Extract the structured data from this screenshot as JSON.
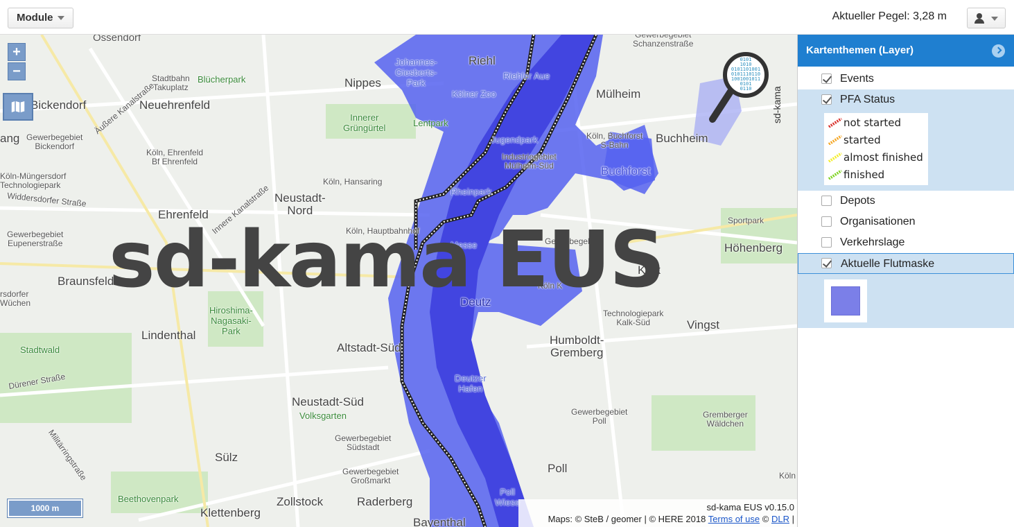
{
  "topbar": {
    "module_label": "Module",
    "pegel_text": "Aktueller Pegel: 3,28 m",
    "user_icon": "user-icon"
  },
  "map": {
    "zoom_in": "+",
    "zoom_out": "−",
    "watermark": "sd-kama EUS",
    "scale": "1000 m",
    "version": "sd-kama EUS v0.15.0",
    "attribution_prefix": "Maps: © SteB / geomer | © HERE 2018",
    "terms_link": "Terms of use",
    "copyright_sep": "©",
    "dlr_link": "DLR",
    "trailing": "|",
    "side_label": "sd-kama",
    "logo_digits": "0101\n1010\n0101101001\n0101110110\n1001001011\n0101\n0110",
    "flood_color": "#5561f0",
    "labels": {
      "ossendorf": "Ossendorf",
      "riehl": "Riehl",
      "nippes": "Nippes",
      "mulheim": "Mülheim",
      "bickendorf": "Bickendorf",
      "neuehrenfeld": "Neuehrenfeld",
      "buchheim": "Buchheim",
      "ang": "ang",
      "ehrenfeld": "Ehrenfeld",
      "neustadt_nord": "Neustadt-\nNord",
      "buchforst": "Buchforst",
      "braunsfeld": "Braunsfeld",
      "deutz": "Deutz",
      "kalk": "Kalk",
      "hohenberg": "Höhenberg",
      "vingst": "Vingst",
      "lindenthal": "Lindenthal",
      "altstadt_sud": "Altstadt-Süd",
      "humboldt": "Humboldt-\nGremberg",
      "neustadt_sud": "Neustadt-Süd",
      "sulz": "Sülz",
      "poll": "Poll",
      "zollstock": "Zollstock",
      "raderberg": "Raderberg",
      "klettenberg": "Klettenberg",
      "bayenthal": "Bayenthal",
      "stadtbahn": "Stadtbahn\nTakuplatz",
      "blucherpark": "Blücherpark",
      "innerer": "Innerer\nGrüngürtel",
      "lentpark": "Lentpark",
      "kolner_zoo": "Kölner Zoo",
      "johannes": "Johannes-\nGiesberts-\nPark",
      "riehler_aue": "Riehler Aue",
      "jugendpark": "Jugendpark",
      "industrie": "Industriegebiet\nMülheim-Süd",
      "koln_buchforst": "Köln, Buchforst\nS-Bahn",
      "gewerbe_schanzen": "Gewerbegebiet\nSchanzenstraße",
      "gewerbe_bickendorf": "Gewerbegebiet\nBickendorf",
      "koln_ehrenfeld": "Köln, Ehrenfeld\nBf Ehrenfeld",
      "koln_mungersdorf": "Köln-Müngersdorf\nTechnologiepark",
      "koln_hansaring": "Köln, Hansaring",
      "widdersdorfer": "Widdersdorfer Straße",
      "gewerbe_eupener": "Gewerbegebiet\nEupenerstraße",
      "koln_hbf": "Köln, Hauptbahnhof",
      "rheinpark": "Rheinpark",
      "messe": "Messe",
      "gewerbe_kalk": "Gewerbegebiet",
      "sportpark": "Sportpark",
      "koln_k": "Köln K",
      "hiroshima": "Hiroshima-\nNagasaki-\nPark",
      "technologiepark_kalk": "Technologiepark\nKalk-Süd",
      "rsdorfer": "rsdorfer\nWüchen",
      "stadtwald": "Stadtwald",
      "durener": "Dürener Straße",
      "volksgarten": "Volksgarten",
      "deutzer_hafen": "Deutzer\nHafen",
      "gewerbe_poll": "Gewerbegebiet\nPoll",
      "gremberger": "Gremberger\nWäldchen",
      "gewerbe_sudstadt": "Gewerbegebiet\nSüdstadt",
      "gewerbe_grossmarkt": "Gewerbegebiet\nGroßmarkt",
      "militar": "Militärringstraße",
      "beethovenpark": "Beethovenpark",
      "poll_wiese": "Poll\nWiese",
      "koln_right": "Köln",
      "kanalstrasse": "Innere Kanalstraße",
      "aussere": "Äußere Kanalstraße"
    }
  },
  "panel": {
    "title": "Kartenthemen (Layer)",
    "layers": [
      {
        "label": "Events",
        "checked": true
      },
      {
        "label": "PFA Status",
        "checked": true
      },
      {
        "label": "Depots",
        "checked": false
      },
      {
        "label": "Organisationen",
        "checked": false
      },
      {
        "label": "Verkehrslage",
        "checked": false
      },
      {
        "label": "Aktuelle Flutmaske",
        "checked": true
      }
    ],
    "pfa_legend": [
      {
        "label": "not started",
        "color": "#d9302b"
      },
      {
        "label": "started",
        "color": "#f5a623"
      },
      {
        "label": "almost finished",
        "color": "#f4ee2a"
      },
      {
        "label": "finished",
        "color": "#7ed321"
      }
    ],
    "flood_swatch_color": "#7b7fe8"
  }
}
